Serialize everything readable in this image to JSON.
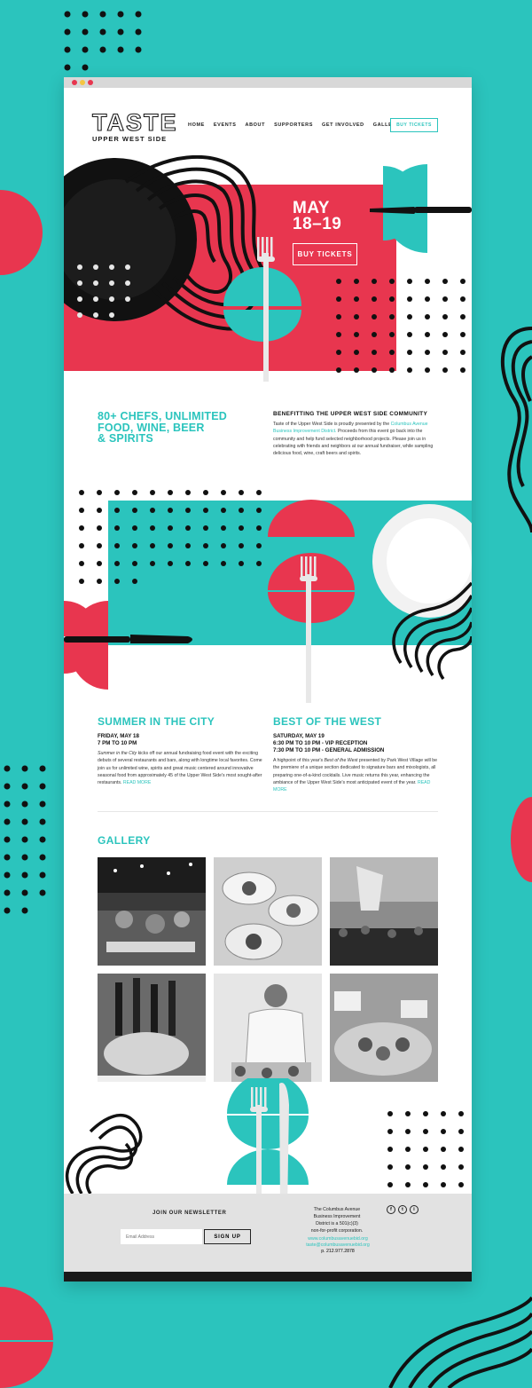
{
  "colors": {
    "teal": "#2bc4bd",
    "red": "#e8364f",
    "black": "#1a1a1a"
  },
  "nav": {
    "logo_main": "TASTE",
    "logo_sub": "UPPER WEST SIDE",
    "links": [
      "HOME",
      "EVENTS",
      "ABOUT",
      "SUPPORTERS",
      "GET INVOLVED",
      "GALLERY"
    ],
    "cta": "BUY TICKETS"
  },
  "hero": {
    "date_line1": "MAY",
    "date_line2": "18–19",
    "cta": "BUY TICKETS"
  },
  "intro": {
    "headline_1": "80+ CHEFS, UNLIMITED",
    "headline_2": "FOOD, WINE, BEER",
    "headline_3": "& SPIRITS",
    "subhead": "BENEFITTING THE UPPER WEST SIDE COMMUNITY",
    "body_before": "Taste of the Upper West Side is proudly presented by the",
    "body_link": "Columbus Avenue Business Improvement District.",
    "body_after": "Proceeds from this event go back into the community and help fund selected neighborhood projects. Please join us in celebrating with friends and neighbors at our annual fundraiser, while sampling delicious food, wine, craft beers and spirits."
  },
  "events": [
    {
      "title": "SUMMER IN THE CITY",
      "meta_1": "FRIDAY, MAY 18",
      "meta_2": "7 PM TO 10 PM",
      "meta_3": "",
      "body_em": "Summer in the City",
      "body": "kicks off our annual fundraising food event with the exciting debuts of several restaurants and bars, along with longtime local favorites. Come join us for unlimited wine, spirits and great music centered around innovative seasonal food from approximately 45 of the Upper West Side's most sought-after restaurants.",
      "read_more": "READ MORE"
    },
    {
      "title": "BEST OF THE WEST",
      "meta_1": "SATURDAY, MAY 19",
      "meta_2": "6:30 PM TO 10 PM - VIP RECEPTION",
      "meta_3": "7:30 PM TO 10 PM - GENERAL ADMISSION",
      "body_pre": "A highpoint of this year's",
      "body_em": "Best of the West",
      "body": "presented by Park West Village will be the premiere of a unique section dedicated to signature bars and mixologists, all preparing one-of-a-kind cocktails. Live music returns this year, enhancing the ambiance of the Upper West Side's most anticipated event of the year.",
      "read_more": "READ MORE"
    }
  ],
  "gallery": {
    "title": "GALLERY"
  },
  "footer": {
    "newsletter_title": "JOIN OUR NEWSLETTER",
    "email_placeholder": "Email Address",
    "signup": "SIGN UP",
    "cbid_1": "The Columbus Avenue",
    "cbid_2": "Business Improvement",
    "cbid_3": "District is a 501(c)(3)",
    "cbid_4": "non-for-profit corporation.",
    "website": "www.columbusavenuebid.org",
    "email": "taste@columbusavenuebid.org",
    "phone": "p. 212.977.2878",
    "socials": [
      "f",
      "t",
      "i"
    ],
    "social_icons": [
      "facebook-icon",
      "twitter-icon",
      "instagram-icon"
    ]
  }
}
